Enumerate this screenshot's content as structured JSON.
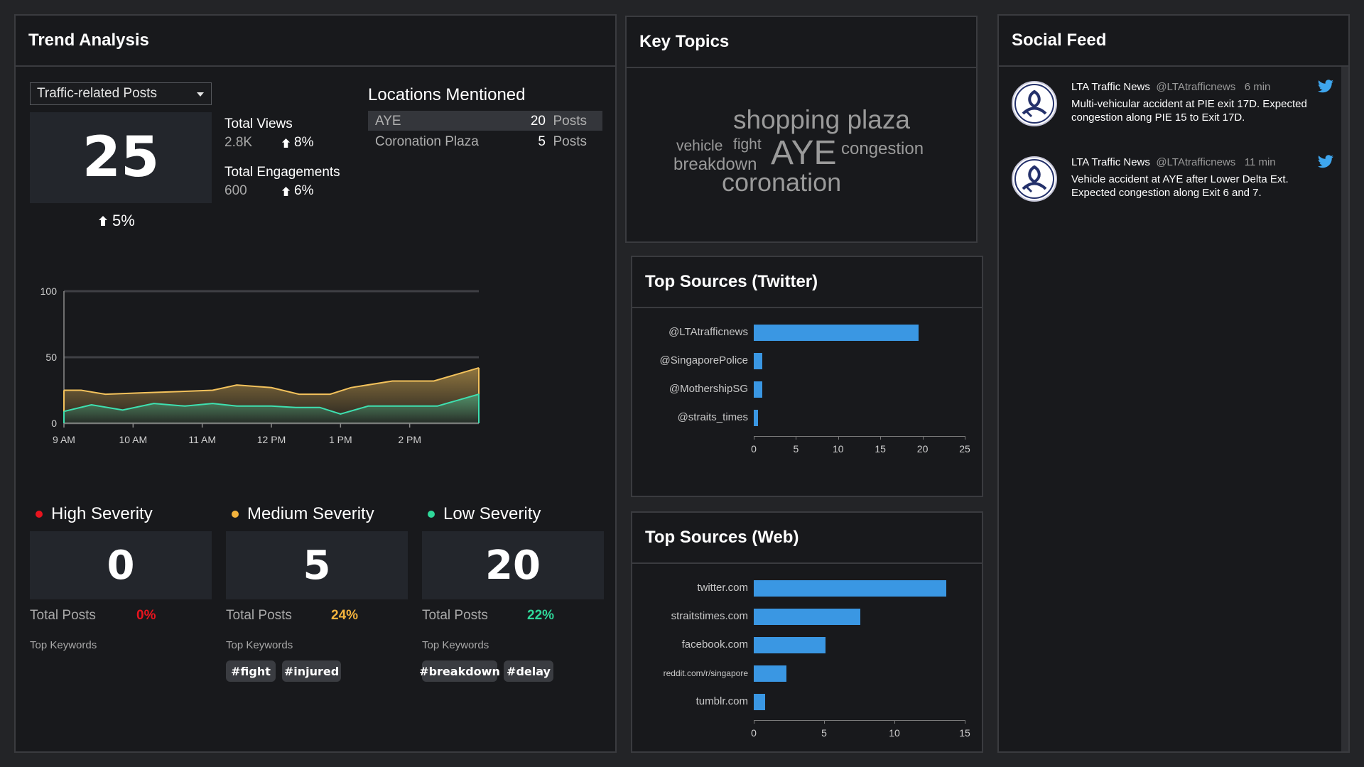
{
  "trend": {
    "title": "Trend Analysis",
    "dropdown": "Traffic-related Posts",
    "count": "25",
    "count_change": "5%",
    "views_label": "Total Views",
    "views_value": "2.8K",
    "views_change": "8%",
    "engagements_label": "Total Engagements",
    "engagements_value": "600",
    "engagements_change": "6%",
    "locations_title": "Locations Mentioned",
    "locations": [
      {
        "name": "AYE",
        "count": "20",
        "unit": "Posts"
      },
      {
        "name": "Coronation Plaza",
        "count": "5",
        "unit": "Posts"
      }
    ],
    "severity": [
      {
        "title": "High Severity",
        "count": "0",
        "total_label": "Total Posts",
        "pct": "0%",
        "color": "#e8141e",
        "keywords_label": "Top Keywords",
        "keywords": []
      },
      {
        "title": "Medium Severity",
        "count": "5",
        "total_label": "Total Posts",
        "pct": "24%",
        "color": "#f3b33d",
        "keywords_label": "Top Keywords",
        "keywords": [
          "#fight",
          "#injured"
        ]
      },
      {
        "title": "Low Severity",
        "count": "20",
        "total_label": "Total Posts",
        "pct": "22%",
        "color": "#2fd89a",
        "keywords_label": "Top Keywords",
        "keywords": [
          "#breakdown",
          "#delay"
        ]
      }
    ]
  },
  "chart_data": [
    {
      "type": "area",
      "x": [
        "9 AM",
        "9:30 AM",
        "10 AM",
        "10:30 AM",
        "11 AM",
        "11:30 AM",
        "12 PM",
        "12:30 PM",
        "1 PM",
        "1:30 PM",
        "2 PM"
      ],
      "x_tick_labels": [
        "9 AM",
        "10 AM",
        "11 AM",
        "12 PM",
        "1 PM",
        "2 PM"
      ],
      "y_tick_labels": [
        "0",
        "50",
        "100"
      ],
      "ylim": [
        0,
        100
      ],
      "series_points": [
        {
          "color": "#f3c25c",
          "x": [
            0,
            0.25,
            0.6,
            1.1,
            1.65,
            2.15,
            2.5,
            3.0,
            3.4,
            3.85,
            4.15,
            4.75,
            5.35,
            6.0
          ],
          "y": [
            25,
            25,
            22,
            23,
            24,
            25,
            29,
            27,
            22,
            22,
            27,
            32,
            32,
            42
          ]
        },
        {
          "color": "#3ee0b0",
          "x": [
            0,
            0.4,
            0.85,
            1.3,
            1.75,
            2.15,
            2.5,
            3.0,
            3.35,
            3.7,
            4.0,
            4.4,
            4.85,
            5.4,
            6.0
          ],
          "y": [
            9,
            14,
            10,
            15,
            13,
            15,
            13,
            13,
            12,
            12,
            7,
            13,
            13,
            13,
            22
          ]
        }
      ]
    },
    {
      "type": "bar",
      "title": "Top Sources (Twitter)",
      "categories": [
        "@LTAtrafficnews",
        "@SingaporePolice",
        "@MothershipSG",
        "@straits_times"
      ],
      "values": [
        19.5,
        1,
        1,
        0.5
      ],
      "xlim": [
        0,
        25
      ],
      "ticks": [
        "0",
        "5",
        "10",
        "15",
        "20",
        "25"
      ],
      "color": "#3a97e3"
    },
    {
      "type": "bar",
      "title": "Top Sources (Web)",
      "categories": [
        "twitter.com",
        "straitstimes.com",
        "facebook.com",
        "reddit.com/r/singapore",
        "tumblr.com"
      ],
      "values": [
        13.7,
        7.6,
        5.1,
        2.3,
        0.8
      ],
      "xlim": [
        0,
        15
      ],
      "ticks": [
        "0",
        "5",
        "10",
        "15"
      ],
      "color": "#3a97e3"
    }
  ],
  "topics": {
    "title": "Key Topics",
    "words": [
      "shopping plaza",
      "vehicle",
      "fight",
      "AYE",
      "congestion",
      "breakdown",
      "coronation"
    ]
  },
  "twitter_sources": {
    "title": "Top Sources (Twitter)"
  },
  "web_sources": {
    "title": "Top Sources (Web)"
  },
  "feed": {
    "title": "Social Feed",
    "items": [
      {
        "name": "LTA Traffic News",
        "handle": "@LTAtrafficnews",
        "time": "6 min",
        "text": "Multi-vehicular accident at PIE exit 17D. Expected congestion along PIE 15 to Exit 17D.",
        "icon": "twitter-bird-icon"
      },
      {
        "name": "LTA Traffic News",
        "handle": "@LTAtrafficnews",
        "time": "11 min",
        "text": "Vehicle accident at AYE after Lower Delta Ext. Expected congestion along Exit 6 and 7.",
        "icon": "twitter-bird-icon"
      }
    ]
  }
}
